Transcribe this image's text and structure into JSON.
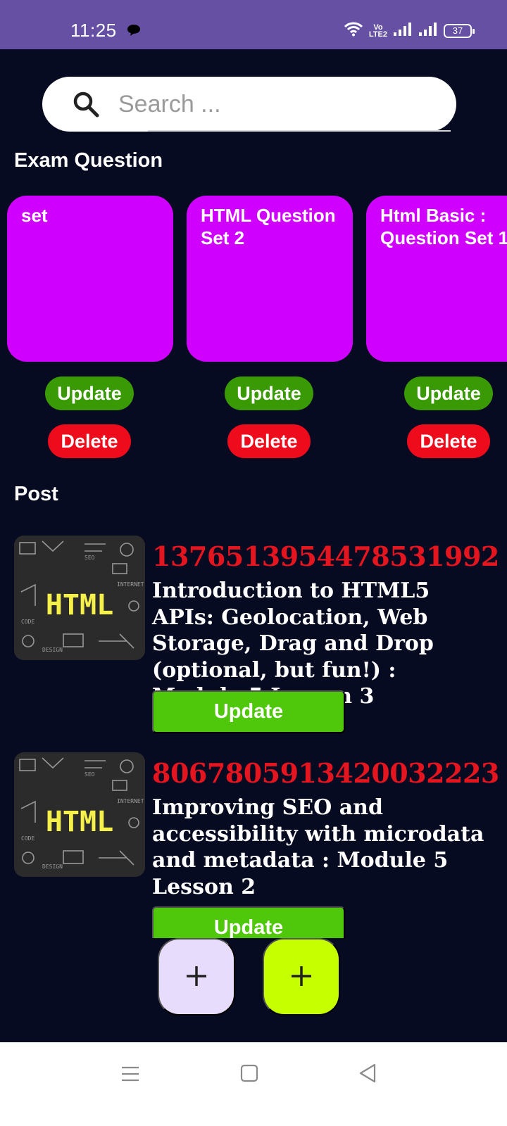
{
  "status_bar": {
    "time": "11:25",
    "battery": "37",
    "volte_top": "Vo",
    "volte_bottom": "LTE2",
    "icons": [
      "message-icon",
      "wifi-icon",
      "volte-icon",
      "signal-icon",
      "signal-icon",
      "battery-icon"
    ]
  },
  "search": {
    "placeholder": "Search ..."
  },
  "exam_section": {
    "title": "Exam Question",
    "cards": [
      {
        "title": "set",
        "update_label": "Update",
        "delete_label": "Delete"
      },
      {
        "title": "HTML Question Set 2",
        "update_label": "Update",
        "delete_label": "Delete"
      },
      {
        "title": "Html Basic : Question Set 1",
        "update_label": "Update",
        "delete_label": "Delete"
      }
    ]
  },
  "post_section": {
    "title": "Post",
    "posts": [
      {
        "thumb_text": "HTML",
        "id": "1376513954478531992",
        "title": "Introduction to HTML5 APIs: Geolocation, Web Storage, Drag and Drop (optional, but fun!) : Module 5 Lesson 3",
        "update_label": "Update"
      },
      {
        "thumb_text": "HTML",
        "id": "8067805913420032223",
        "title": "Improving SEO and accessibility with microdata and metadata : Module 5 Lesson 2",
        "update_label": "Update"
      }
    ]
  },
  "fabs": [
    {
      "icon": "plus-icon"
    },
    {
      "icon": "plus-icon"
    }
  ],
  "nav_bar": {
    "icons": [
      "menu-icon",
      "home-square-icon",
      "back-triangle-icon"
    ]
  },
  "colors": {
    "status_bar": "#6650a4",
    "background": "#070b22",
    "card": "#d000ff",
    "update_pill": "#3a9a06",
    "delete_pill": "#ee0b1c",
    "post_id": "#e51520",
    "post_update": "#4fc70a",
    "fab_1": "#e7dcfb",
    "fab_2": "#c6ff00"
  }
}
